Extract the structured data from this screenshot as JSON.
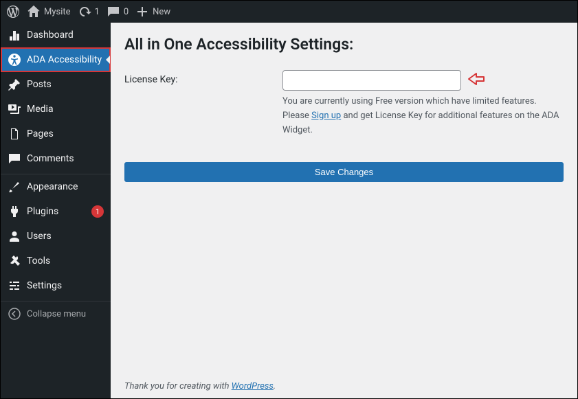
{
  "adminbar": {
    "site_name": "Mysite",
    "updates_count": "1",
    "comments_count": "0",
    "new_label": "New"
  },
  "sidebar": {
    "dashboard": "Dashboard",
    "ada": "ADA Accessibility",
    "posts": "Posts",
    "media": "Media",
    "pages": "Pages",
    "comments": "Comments",
    "appearance": "Appearance",
    "plugins": "Plugins",
    "plugins_badge": "1",
    "users": "Users",
    "tools": "Tools",
    "settings": "Settings",
    "collapse": "Collapse menu"
  },
  "page": {
    "title": "All in One Accessibility Settings:",
    "license_label": "License Key:",
    "license_value": "",
    "helper1": "You are currently using Free version which have limited features.",
    "helper2a": "Please ",
    "signup": "Sign up",
    "helper2b": " and get License Key for additional features on the ADA Widget.",
    "save": "Save Changes",
    "footer_prefix": "Thank you for creating with ",
    "footer_link": "WordPress",
    "footer_suffix": "."
  }
}
